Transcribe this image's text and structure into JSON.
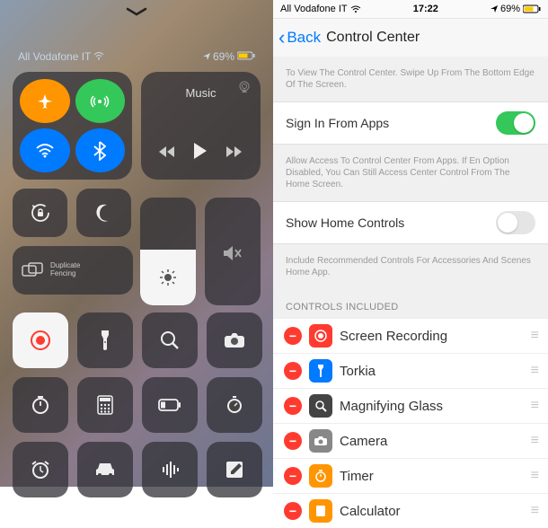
{
  "left": {
    "carrier": "All Vodafone IT",
    "battery": "69%",
    "music_label": "Music",
    "mirror_line1": "Duplicate",
    "mirror_line2": "Fencing"
  },
  "right": {
    "status": {
      "carrier": "All Vodafone IT",
      "time": "17:22",
      "battery": "69%"
    },
    "nav": {
      "back": "Back",
      "title": "Control Center"
    },
    "note1": "To View The Control Center. Swipe Up From The Bottom Edge Of The Screen.",
    "row1_label": "Sign In From Apps",
    "note2": "Allow Access To Control Center From Apps. If En Option Disabled, You Can Still Access Center Control From The Home Screen.",
    "row2_label": "Show Home Controls",
    "note3": "Include Recommended Controls For Accessories And Scenes Home App.",
    "section_header": "CONTROLS INCLUDED",
    "controls": [
      {
        "label": "Screen Recording"
      },
      {
        "label": "Torkia"
      },
      {
        "label": "Magnifying Glass"
      },
      {
        "label": "Camera"
      },
      {
        "label": "Timer"
      },
      {
        "label": "Calculator"
      }
    ]
  }
}
